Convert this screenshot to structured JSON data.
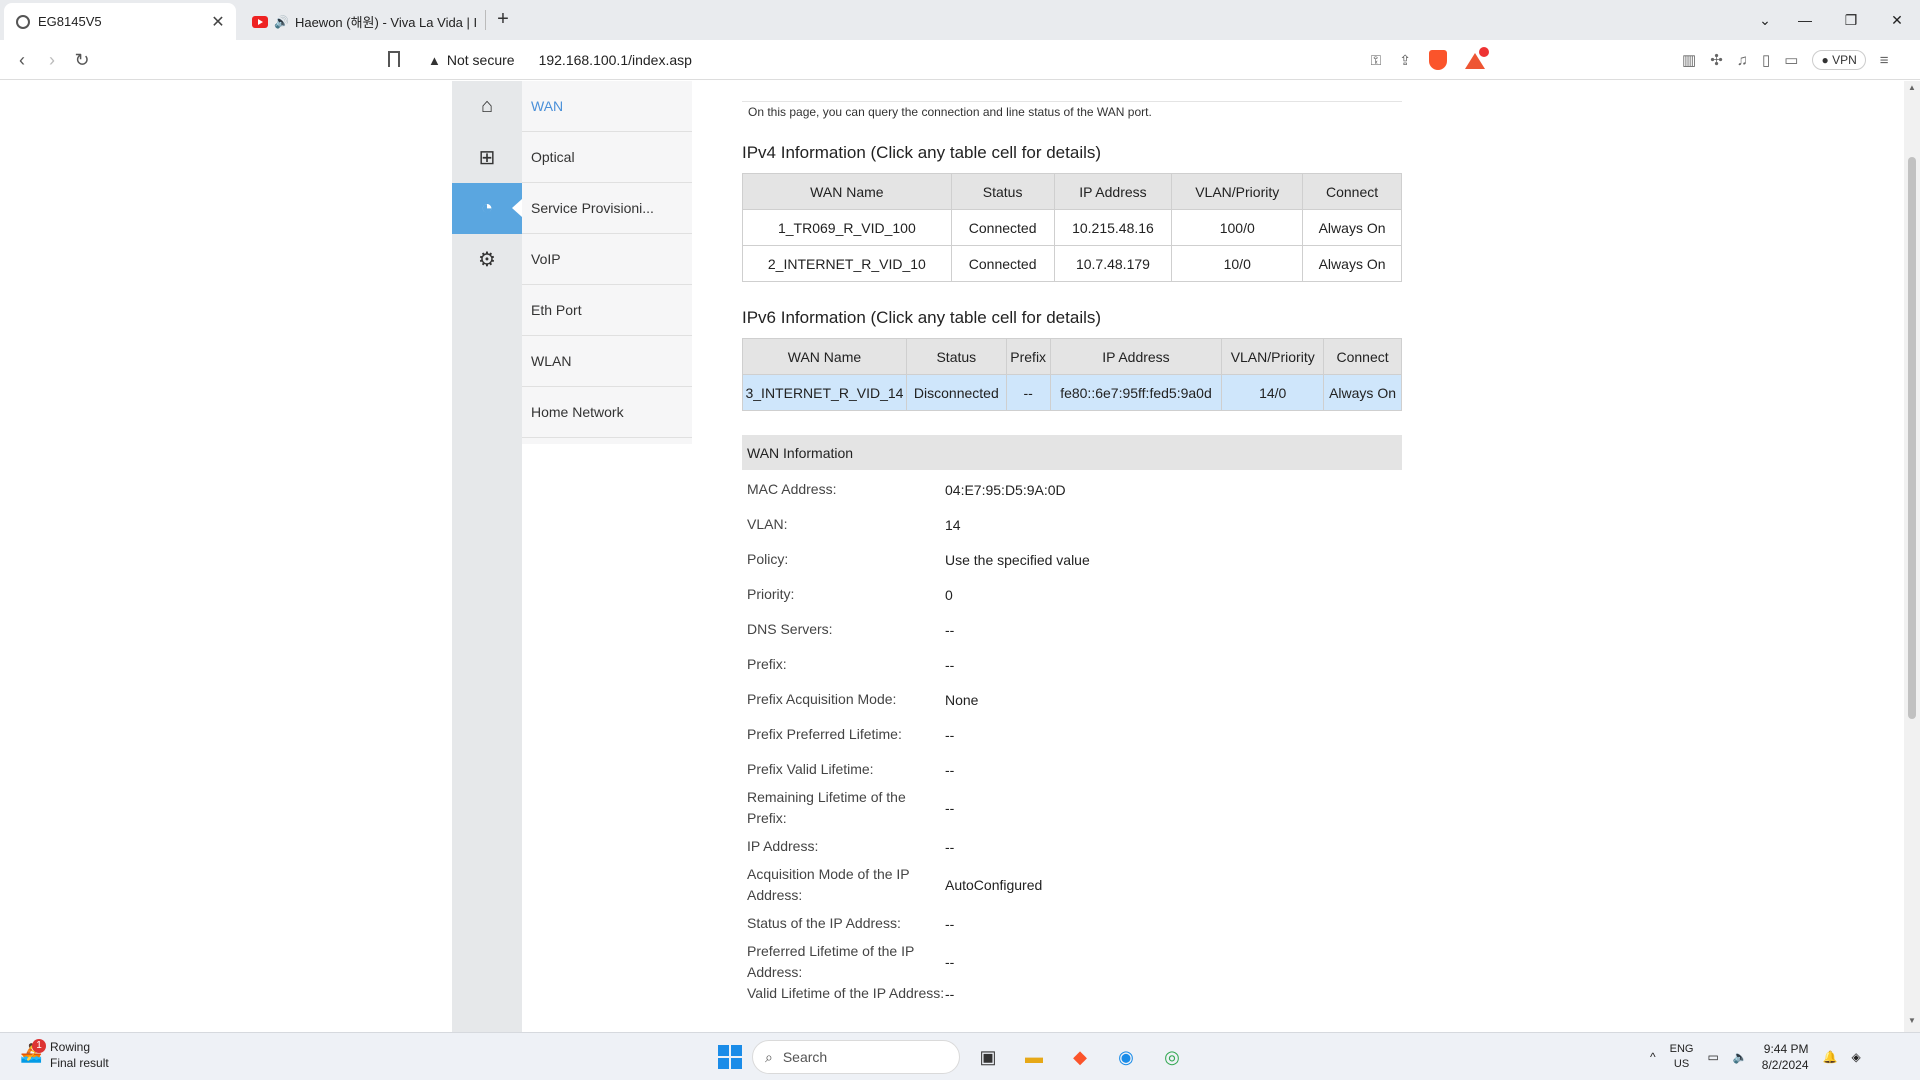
{
  "browser": {
    "tabs": [
      {
        "title": "EG8145V5",
        "active": true
      },
      {
        "title": "Haewon (해원) - Viva La Vida | I",
        "active": false
      }
    ],
    "security_label": "Not secure",
    "url": "192.168.100.1/index.asp",
    "vpn_label": "VPN"
  },
  "sidebar": {
    "icons": [
      "home-icon",
      "service-icon",
      "status-icon",
      "settings-icon"
    ],
    "items": [
      {
        "label": "WAN"
      },
      {
        "label": "Optical"
      },
      {
        "label": "Service Provisioni..."
      },
      {
        "label": "VoIP"
      },
      {
        "label": "Eth Port"
      },
      {
        "label": "WLAN"
      },
      {
        "label": "Home Network"
      }
    ]
  },
  "main": {
    "intro": "On this page, you can query the connection and line status of the WAN port.",
    "ipv4_title": "IPv4 Information (Click any table cell for details)",
    "ipv4_headers": [
      "WAN Name",
      "Status",
      "IP Address",
      "VLAN/Priority",
      "Connect"
    ],
    "ipv4_rows": [
      [
        "1_TR069_R_VID_100",
        "Connected",
        "10.215.48.16",
        "100/0",
        "Always On"
      ],
      [
        "2_INTERNET_R_VID_10",
        "Connected",
        "10.7.48.179",
        "10/0",
        "Always On"
      ]
    ],
    "ipv6_title": "IPv6 Information (Click any table cell for details)",
    "ipv6_headers": [
      "WAN Name",
      "Status",
      "Prefix",
      "IP Address",
      "VLAN/Priority",
      "Connect"
    ],
    "ipv6_rows": [
      [
        "3_INTERNET_R_VID_14",
        "Disconnected",
        "--",
        "fe80::6e7:95ff:fed5:9a0d",
        "14/0",
        "Always On"
      ]
    ],
    "wan_info_title": "WAN Information",
    "wan_info": [
      {
        "label": "MAC Address:",
        "value": "04:E7:95:D5:9A:0D"
      },
      {
        "label": "VLAN:",
        "value": "14"
      },
      {
        "label": "Policy:",
        "value": "Use the specified value"
      },
      {
        "label": "Priority:",
        "value": "0"
      },
      {
        "label": "DNS Servers:",
        "value": "--"
      },
      {
        "label": "Prefix:",
        "value": "--"
      },
      {
        "label": "Prefix Acquisition Mode:",
        "value": "None"
      },
      {
        "label": "Prefix Preferred Lifetime:",
        "value": "--"
      },
      {
        "label": "Prefix Valid Lifetime:",
        "value": "--"
      },
      {
        "label": "Remaining Lifetime of the Prefix:",
        "value": "--"
      },
      {
        "label": "IP Address:",
        "value": "--"
      },
      {
        "label": "Acquisition Mode of the IP Address:",
        "value": "AutoConfigured"
      },
      {
        "label": "Status of the IP Address:",
        "value": "--"
      },
      {
        "label": "Preferred Lifetime of the IP Address:",
        "value": "--"
      },
      {
        "label": "Valid Lifetime of the IP Address:",
        "value": "--"
      }
    ]
  },
  "taskbar": {
    "weather_title": "Rowing",
    "weather_sub": "Final result",
    "weather_badge": "1",
    "search_placeholder": "Search",
    "lang_top": "ENG",
    "lang_bottom": "US",
    "time": "9:44 PM",
    "date": "8/2/2024"
  }
}
